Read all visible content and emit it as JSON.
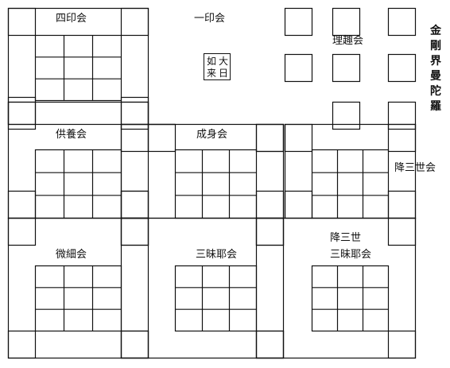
{
  "title": "金剛界曼陀羅",
  "assemblies": {
    "shiin": "四印会",
    "ichiin": "一印会",
    "rishu": "理趣会",
    "kuyo": "供養会",
    "jojin": "成身会",
    "gosanze": "降三世会",
    "misai": "微細会",
    "sanmaya": "三昧耶会",
    "gosanze_sanmaya_1": "降三世",
    "gosanze_sanmaya_2": "三昧耶会"
  },
  "dainichi": {
    "left": "如来",
    "right": "大日"
  },
  "colors": {
    "line": "#111111",
    "background": "#ffffff"
  }
}
